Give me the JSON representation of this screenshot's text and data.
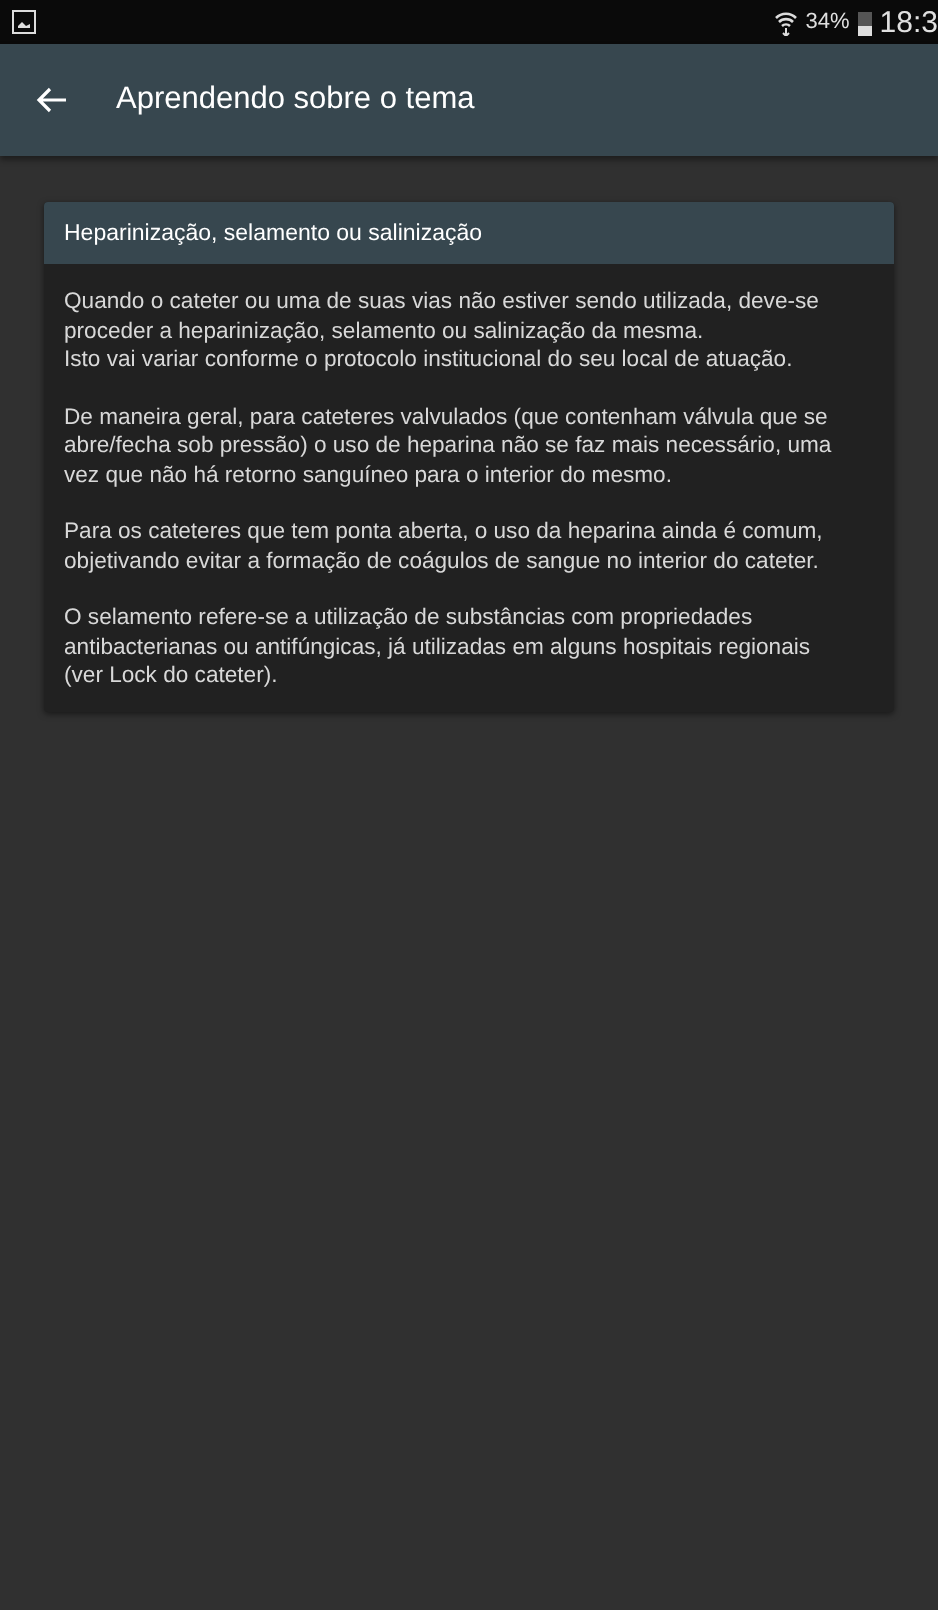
{
  "status_bar": {
    "battery": "34%",
    "time": "18:3"
  },
  "app_bar": {
    "title": "Aprendendo sobre o tema"
  },
  "card": {
    "header": "Heparinização, selamento ou salinização",
    "paragraphs": [
      [
        "Quando o cateter ou uma de suas vias não estiver sendo utilizada, deve-se",
        "proceder a heparinização, selamento ou salinização da mesma.",
        "Isto vai variar conforme o protocolo institucional do seu local de atuação."
      ],
      [
        "De maneira geral, para cateteres valvulados (que contenham válvula que se",
        "abre/fecha sob pressão) o uso de heparina não se faz mais necessário, uma",
        "vez que não há retorno sanguíneo para o interior do mesmo."
      ],
      [
        "Para os cateteres que tem ponta aberta, o uso da heparina ainda é comum,",
        "objetivando evitar a formação de coágulos de sangue no interior do cateter."
      ],
      [
        "O selamento refere-se a utilização de substâncias com propriedades",
        "antibacterianas ou antifúngicas, já utilizadas em alguns hospitais regionais",
        "(ver Lock do cateter)."
      ]
    ]
  }
}
